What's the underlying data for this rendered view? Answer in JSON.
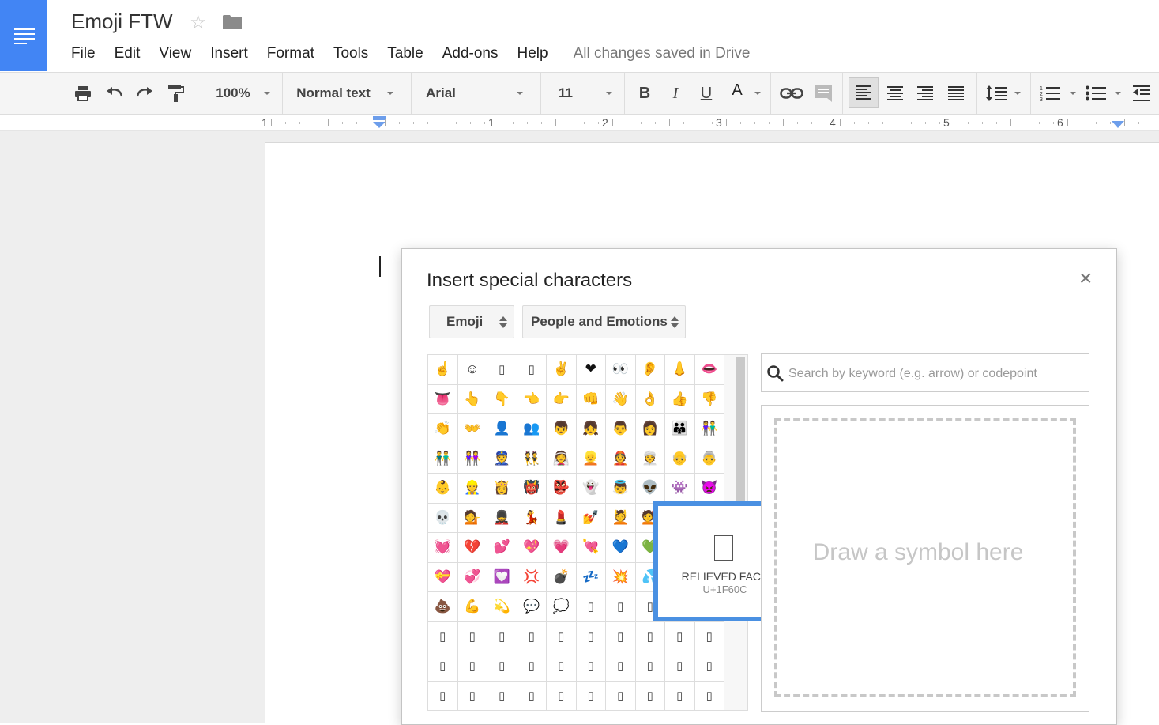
{
  "doc": {
    "title": "Emoji FTW",
    "star_glyph": "☆",
    "save_status": "All changes saved in Drive"
  },
  "menu": [
    "File",
    "Edit",
    "View",
    "Insert",
    "Format",
    "Tools",
    "Table",
    "Add-ons",
    "Help"
  ],
  "toolbar": {
    "zoom": "100%",
    "style": "Normal text",
    "font": "Arial",
    "size": "11",
    "bold": "B",
    "italic": "I",
    "underline": "U",
    "text_color": "A",
    "text_color_value": "#000000"
  },
  "ruler": {
    "numbers": [
      "1",
      "1",
      "2",
      "3",
      "4",
      "5",
      "6"
    ]
  },
  "dialog": {
    "title": "Insert special characters",
    "close": "×",
    "category": "Emoji",
    "subcategory": "People and Emotions",
    "search_placeholder": "Search by keyword (e.g. arrow) or codepoint",
    "draw_hint": "Draw a symbol here",
    "preview": {
      "glyph": "",
      "name": "RELIEVED FACE",
      "codepoint": "U+1F60C"
    },
    "accent_color": "#4a90e2"
  },
  "grid": {
    "rows": [
      [
        "☝",
        "☺",
        "▯",
        "▯",
        "✌",
        "❤",
        "👀",
        "👂",
        "👃",
        "👄"
      ],
      [
        "👅",
        "👆",
        "👇",
        "👈",
        "👉",
        "👊",
        "👋",
        "👌",
        "👍",
        "👎"
      ],
      [
        "👏",
        "👐",
        "👤",
        "👥",
        "👦",
        "👧",
        "👨",
        "👩",
        "👪",
        "👫"
      ],
      [
        "👬",
        "👭",
        "👮",
        "👯",
        "👰",
        "👱",
        "👲",
        "👳",
        "👴",
        "👵"
      ],
      [
        "👶",
        "👷",
        "👸",
        "👹",
        "👺",
        "👻",
        "👼",
        "👽",
        "👾",
        "👿"
      ],
      [
        "💀",
        "💁",
        "💂",
        "💃",
        "💄",
        "💅",
        "💆",
        "💇",
        "💋",
        "💌"
      ],
      [
        "💓",
        "💔",
        "💕",
        "💖",
        "💗",
        "💘",
        "💙",
        "💚",
        "💛",
        "💜"
      ],
      [
        "💝",
        "💞",
        "💟",
        "💢",
        "💣",
        "💤",
        "💥",
        "💦",
        "💧",
        "💨"
      ],
      [
        "💩",
        "💪",
        "💫",
        "💬",
        "💭",
        "▯",
        "▯",
        "▯",
        "▯",
        "▯"
      ],
      [
        "▯",
        "▯",
        "▯",
        "▯",
        "▯",
        "▯",
        "▯",
        "▯",
        "▯",
        "▯"
      ],
      [
        "▯",
        "▯",
        "▯",
        "▯",
        "▯",
        "▯",
        "▯",
        "▯",
        "▯",
        "▯"
      ],
      [
        "▯",
        "▯",
        "▯",
        "▯",
        "▯",
        "▯",
        "▯",
        "▯",
        "▯",
        "▯"
      ]
    ]
  }
}
